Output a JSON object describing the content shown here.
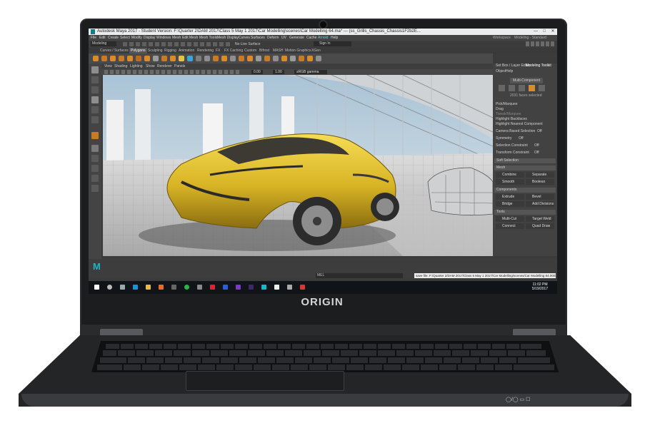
{
  "window": {
    "title": "Autodesk Maya 2017 - Student Version: F:\\Quarter 2\\DAM 2017\\Class 5 May 1 2017\\Car Modelling\\scenes\\Car Modelling 64.ma* --- (ss_Grills_Chassis_Chassis1F2b2E...",
    "minimize_label": "—",
    "maximize_label": "□",
    "close_label": "✕"
  },
  "menubar": {
    "items": [
      "File",
      "Edit",
      "Create",
      "Select",
      "Modify",
      "Display",
      "Windows",
      "Mesh",
      "Edit Mesh",
      "Mesh Tools",
      "Mesh Display",
      "Curves",
      "Surfaces",
      "Deform",
      "UV",
      "Generate",
      "Cache",
      "Arnold",
      "Help"
    ],
    "workspace_label": "Workspace",
    "workspace_value": "Modeling - Standard"
  },
  "statusline": {
    "mode": "Modeling",
    "live_surface": "No Live Surface",
    "sign_in": "Sign In"
  },
  "shelf_tabs": [
    "Curves / Surfaces",
    "Polygons",
    "Sculpting",
    "Rigging",
    "Animation",
    "Rendering",
    "FX",
    "FX Caching",
    "Custom",
    "Bifrost",
    "MASH",
    "Motion Graphics",
    "XGen"
  ],
  "viewport_menu": [
    "View",
    "Shading",
    "Lighting",
    "Show",
    "Renderer",
    "Panels"
  ],
  "viewport_fields": {
    "exposure": "0.00",
    "gamma": "1.00",
    "color_space": "sRGB gamma"
  },
  "panel": {
    "tabs": [
      "Set Box / Layer Editor",
      "Modeling Toolkit"
    ],
    "submenu": [
      "Object",
      "Help"
    ],
    "mode_label": "Multi-Component",
    "selection_info": "2031 faces selected",
    "pick_marquee": "Pick/Marquee",
    "drag": "Drag",
    "tweak_marquee": "Tweak/Marquee",
    "highlight_backfaces": "Highlight Backfaces",
    "highlight_nearest": "Highlight Nearest Component",
    "camera_based": "Camera Based Selection",
    "camera_based_value": "Off",
    "symmetry": "Symmetry",
    "symmetry_value": "Off",
    "selection_constraint": "Selection Constraint",
    "selection_constraint_value": "Off",
    "transform_constraint": "Transform Constraint",
    "transform_constraint_value": "Off",
    "soft_selection": "Soft Selection",
    "sections": {
      "mesh": "Mesh",
      "components": "Components",
      "tools": "Tools"
    },
    "mesh_buttons": [
      "Combine",
      "Separate",
      "Smooth",
      "Boolean"
    ],
    "component_buttons": [
      "Extrude",
      "Bevel",
      "Bridge",
      "Add Divisions"
    ],
    "tool_buttons": [
      "Multi-Cut",
      "Target Weld",
      "Connect",
      "Quad Draw"
    ]
  },
  "command_line": {
    "language": "MEL",
    "path": "save file: F:/Quarter 2/DAM 2017/Class 5 May 1 2017/Car Modelling/scenes/Car Modelling 64.0002.ma"
  },
  "taskbar": {
    "time": "11:02 PM",
    "date": "5/19/2017"
  },
  "brand": {
    "logo_text": "ORIGIN",
    "maya_logo_text": "M"
  },
  "indicators": "◯/◯ ▭ ☐"
}
